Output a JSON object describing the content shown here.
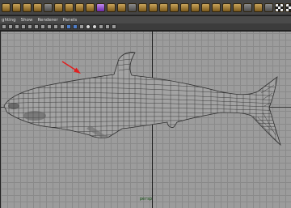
{
  "menubar": {
    "items": [
      "ghting",
      "Show",
      "Renderer",
      "Panels"
    ]
  },
  "viewport": {
    "label": "persp"
  },
  "icons": {
    "shelf": "shelf-tool-icons",
    "annotation": "red-arrow-icon"
  },
  "colors": {
    "arrow": "#e02020",
    "viewport_bg": "#9c9c9c"
  }
}
